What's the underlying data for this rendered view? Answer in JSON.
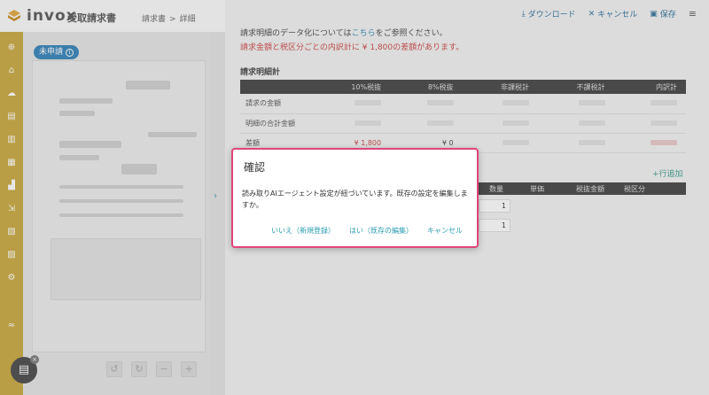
{
  "app": {
    "name": "invox",
    "product": "受取請求書"
  },
  "breadcrumb": {
    "item1": "請求書",
    "sep": ">",
    "item2": "詳細"
  },
  "status_badge": {
    "label": "未申請",
    "icon": "info-icon"
  },
  "toolbar": {
    "download": "ダウンロード",
    "cancel": "キャンセル",
    "save": "保存",
    "menu_icon": "hamburger-icon"
  },
  "notice": {
    "line1_prefix": "請求明細のデータ化については",
    "line1_link": "こちら",
    "line1_suffix": "をご参照ください。",
    "line2": "請求金額と税区分ごとの内訳計に ¥ 1,800の差額があります。"
  },
  "summary": {
    "title": "請求明細計",
    "columns": [
      "",
      "10%税抜",
      "8%税抜",
      "非課税計",
      "不課税計",
      "内訳計"
    ],
    "rows": [
      {
        "label": "請求の金額"
      },
      {
        "label": "明細の合計金額"
      },
      {
        "label": "差額",
        "c1": "¥ 1,800",
        "c2": "¥ 0"
      }
    ]
  },
  "lines": {
    "add_row": "行追加",
    "columns": [
      "数量",
      "単価",
      "税抜金額",
      "税区分"
    ],
    "rows": [
      {
        "qty": "1"
      },
      {
        "qty": "1"
      }
    ]
  },
  "modal": {
    "title": "確認",
    "body": "読み取りAIエージェント設定が紐づいています。既存の設定を編集しますか。",
    "btn_new": "いいえ（新規登録）",
    "btn_edit": "はい（既存の編集）",
    "btn_cancel": "キャンセル"
  },
  "colors": {
    "nav": "#c9a63a",
    "accent": "#2a9db0",
    "warning": "#cc4444",
    "modal_border": "#e0447a"
  }
}
